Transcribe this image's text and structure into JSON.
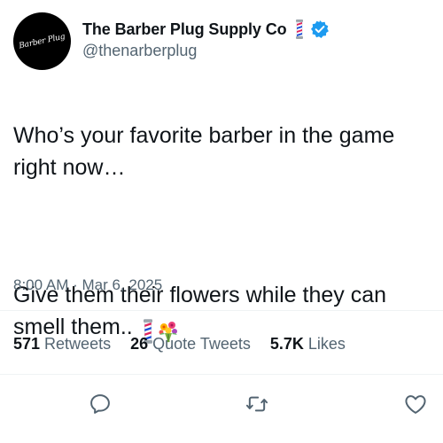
{
  "account": {
    "display_name": "The Barber Plug Supply Co",
    "handle": "@thenarberplug",
    "avatar_text": "Barber Plug",
    "emoji_icon": "barber-pole-icon",
    "verified_icon": "verified-badge-icon"
  },
  "tweet": {
    "line_1": "Who’s your favorite barber in the game right now…",
    "line_2": "Give them their flowers while they can smell them..",
    "emoji": [
      "barber-pole-icon",
      "bouquet-icon"
    ],
    "timestamp": "8:00 AM · Mar 6, 2025"
  },
  "stats": [
    {
      "value": "571",
      "label": "Retweets"
    },
    {
      "value": "26",
      "label": "Quote Tweets"
    },
    {
      "value": "5.7K",
      "label": "Likes"
    }
  ],
  "actions": [
    "reply-icon",
    "retweet-icon",
    "like-icon"
  ],
  "colors": {
    "text": "#0f1419",
    "secondary": "#536471",
    "verified": "#1d9bf0",
    "divider": "#eff3f4"
  }
}
